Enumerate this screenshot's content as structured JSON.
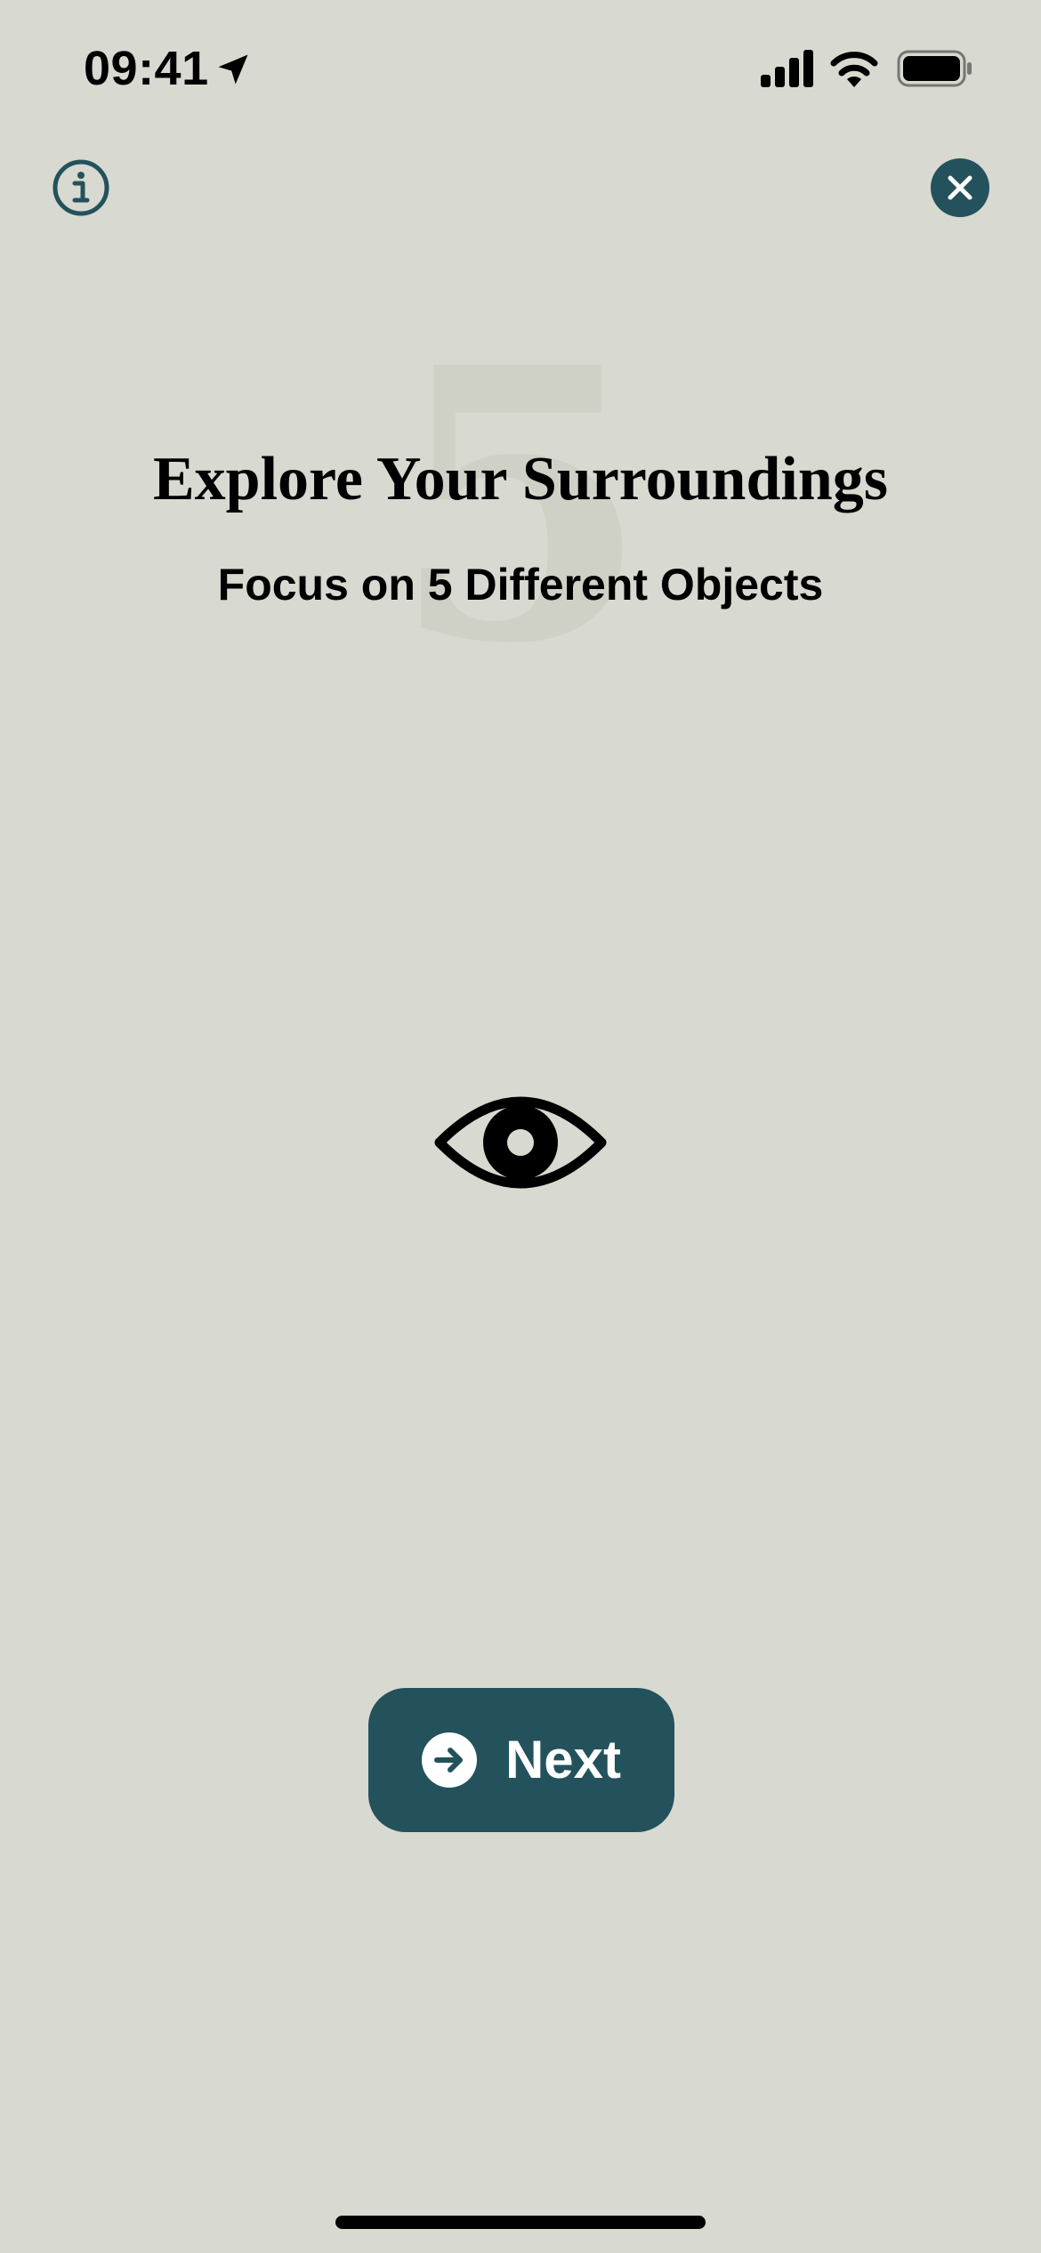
{
  "status_bar": {
    "time": "09:41",
    "icons": [
      "location-arrow-icon",
      "cellular-signal-icon",
      "wifi-icon",
      "battery-icon"
    ]
  },
  "top_bar": {
    "info_icon": "info-circle-icon",
    "close_icon": "close-x-icon"
  },
  "content": {
    "watermark_number": "5",
    "title": "Explore Your Surroundings",
    "subtitle": "Focus on 5 Different Objects",
    "illustration_icon": "eye-icon"
  },
  "actions": {
    "next_label": "Next",
    "next_icon": "arrow-right-circle-icon"
  },
  "colors": {
    "background": "#d8d9d0",
    "accent": "#23525c",
    "text": "#000000",
    "button_text": "#ffffff"
  }
}
